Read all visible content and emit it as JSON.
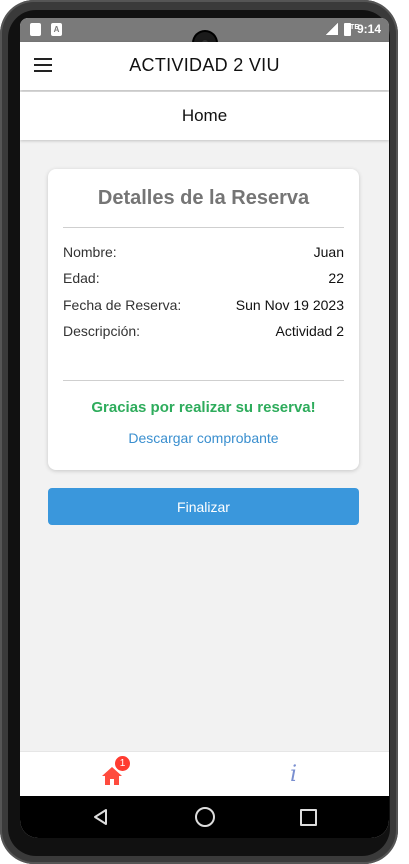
{
  "status_bar": {
    "time": "9:14",
    "network": "LTE"
  },
  "appbar": {
    "title": "ACTIVIDAD 2 VIU"
  },
  "subheader": {
    "title": "Home"
  },
  "card": {
    "title": "Detalles de la Reserva",
    "rows": [
      {
        "label": "Nombre:",
        "value": "Juan"
      },
      {
        "label": "Edad:",
        "value": "22"
      },
      {
        "label": "Fecha de Reserva:",
        "value": "Sun Nov 19 2023"
      },
      {
        "label": "Descripción:",
        "value": "Actividad 2"
      }
    ],
    "thanks": "Gracias por realizar su reserva!",
    "download_link": "Descargar comprobante"
  },
  "finish_button": {
    "label": "Finalizar"
  },
  "tabbar": {
    "home_badge": "1",
    "info_glyph": "i",
    "colors": {
      "home": "#ff4b3e",
      "info": "#7a8fd0"
    }
  },
  "colors": {
    "accent": "#3a97dc",
    "success": "#2eac5c",
    "link": "#3a8fcf"
  }
}
